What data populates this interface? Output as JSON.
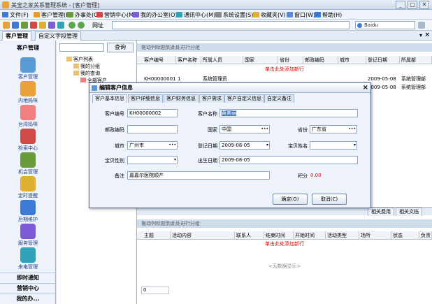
{
  "window": {
    "title": "美宝之家关系管理系统 - [客户管理]",
    "min": "_",
    "max": "□",
    "close": "✕"
  },
  "menu": [
    {
      "label": "文件(F)",
      "color": "#3b7bd6"
    },
    {
      "label": "客户管理(B)",
      "color": "#e49b2e"
    },
    {
      "label": "办事处(G)",
      "color": "#6a9b3b"
    },
    {
      "label": "营销中心(M)",
      "color": "#d64545"
    },
    {
      "label": "我的办公室(O)",
      "color": "#7b5cd6"
    },
    {
      "label": "通讯中心(M)",
      "color": "#2fa3b8"
    },
    {
      "label": "系统设置(S)",
      "color": "#888888"
    },
    {
      "label": "收藏夹(V)",
      "color": "#e0b030"
    },
    {
      "label": "窗口(W)",
      "color": "#5c8bd6"
    },
    {
      "label": "帮助(H)",
      "color": "#3b7bd6"
    }
  ],
  "toolbar": {
    "url_label": "网址",
    "search_placeholder": "Baidu"
  },
  "tabs": [
    "客户管理",
    "自定义字段管理"
  ],
  "leftnav": {
    "header": "客户管理",
    "items": [
      "客户管理",
      "内地妈咪",
      "台湾妈咪",
      "检索中心",
      "机会管理",
      "定时提醒",
      "后期维护",
      "服务管理",
      "来电管理"
    ],
    "footer": [
      "即时通知",
      "营销中心",
      "我的办..."
    ]
  },
  "tree": {
    "query_button": "查询",
    "root": "客户列表",
    "nodes": [
      "我的分组",
      "我的查询",
      "全部客户"
    ]
  },
  "grid_top": {
    "group_hint": "拖动列标题到此处进行分组",
    "columns": [
      "客户编号",
      "客户名称",
      "所属人员",
      "国家",
      "省份",
      "邮政编码",
      "城市",
      "登记日期",
      "所属部"
    ],
    "add_row": "单击此处添加新行",
    "rows": [
      [
        "KH00000001",
        "1",
        "系统管理员",
        "",
        "",
        "",
        "",
        "2009-05-08",
        "系统管理部"
      ],
      [
        "",
        "",
        "",
        "",
        "",
        "",
        "",
        "2009-05-08",
        "系统管理部"
      ]
    ]
  },
  "grid_bottom": {
    "tabs_right": [
      "相关费用",
      "相关文档"
    ],
    "group_hint": "拖动列标题到此处进行分组",
    "columns": [
      "主题",
      "活动内容",
      "联系人",
      "结束时间",
      "开始时间",
      "活动类型",
      "场所",
      "状态",
      "负责"
    ],
    "add_row": "单击此处添加新行",
    "empty": "<无数据显示>",
    "footer_count": "0"
  },
  "dialog": {
    "title": "编辑客户信息",
    "tabs": [
      "客户基本信息",
      "客户详细信息",
      "客户财务信息",
      "客户需求",
      "客户自定义信息",
      "自定义备注"
    ],
    "fields": {
      "customer_no_label": "客户编号",
      "customer_no": "KH00000002",
      "customer_name_label": "客户名称",
      "customer_name": "黄美丽",
      "zip_label": "邮政编码",
      "zip": "",
      "country_label": "国家",
      "country": "中国",
      "province_label": "省份",
      "province": "广东省",
      "city_label": "城市",
      "city": "广州市",
      "reg_date_label": "登记日期",
      "reg_date": "2009-08-05",
      "baby_name_label": "宝贝姓名",
      "baby_name": "",
      "baby_gender_label": "宝贝性别",
      "baby_gender": "",
      "birth_date_label": "出生日期",
      "birth_date": "2009-08-05",
      "note_label": "备注",
      "note": "嘉嘉尔医院顺产",
      "points_label": "积分",
      "points": "0.00"
    },
    "ok": "确定(O)",
    "cancel": "取消(C)",
    "ellipsis": "•••",
    "dropdown": "▾"
  }
}
